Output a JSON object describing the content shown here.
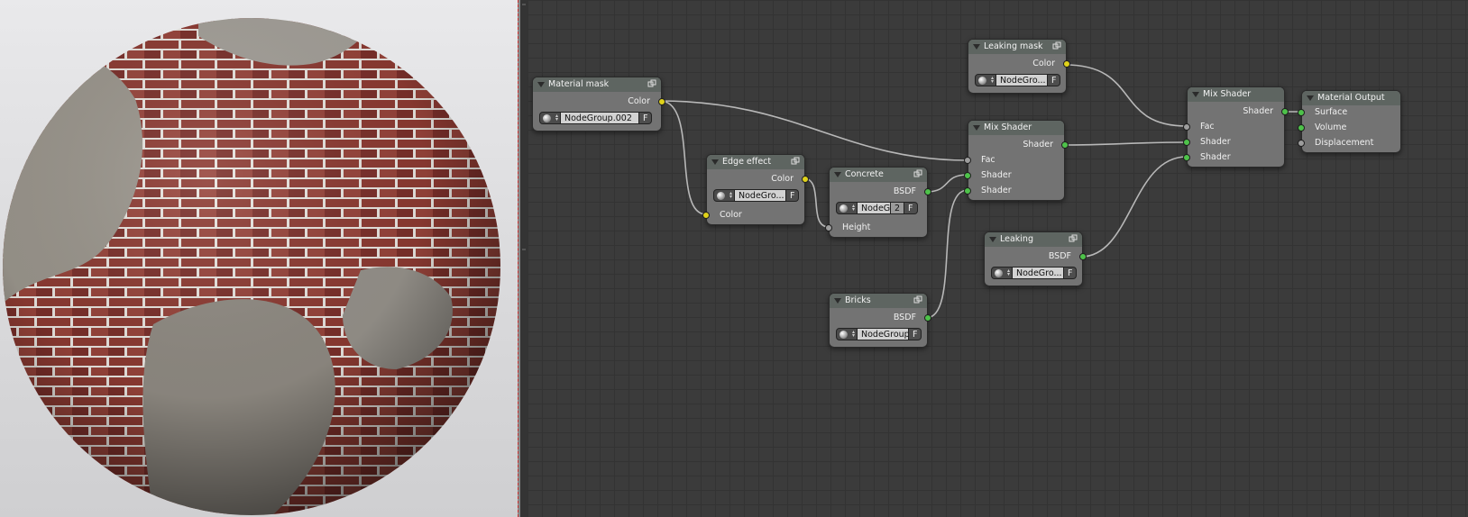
{
  "window": {
    "left_panel": "render-preview",
    "right_panel": "node-editor"
  },
  "colors": {
    "socket_color": "#e0d21a",
    "socket_shader": "#4ec24a",
    "socket_value": "#9d9d9d",
    "node_body": "#737373",
    "node_header": "#5e6561",
    "editor_bg": "#3b3b3b"
  },
  "icons": {
    "collapse": "triangle-down-icon",
    "group": "node-group-icon",
    "material": "material-sphere-icon"
  },
  "nodes": {
    "material_mask": {
      "title": "Material mask",
      "out_color": "Color",
      "group_name": "NodeGroup.002",
      "fake_user": "F"
    },
    "leaking_mask": {
      "title": "Leaking mask",
      "out_color": "Color",
      "group_name": "NodeGro...",
      "fake_user": "F"
    },
    "edge_effect": {
      "title": "Edge effect",
      "out_color": "Color",
      "in_color": "Color",
      "group_name": "NodeGro...",
      "fake_user": "F"
    },
    "concrete": {
      "title": "Concrete",
      "out_bsdf": "BSDF",
      "in_height": "Height",
      "group_name": "NodeG",
      "users": "2",
      "fake_user": "F"
    },
    "bricks": {
      "title": "Bricks",
      "out_bsdf": "BSDF",
      "group_name": "NodeGroup",
      "fake_user": "F"
    },
    "leaking": {
      "title": "Leaking",
      "out_bsdf": "BSDF",
      "group_name": "NodeGro...",
      "fake_user": "F"
    },
    "mix1": {
      "title": "Mix Shader",
      "out_shader": "Shader",
      "in_fac": "Fac",
      "in_shader1": "Shader",
      "in_shader2": "Shader"
    },
    "mix2": {
      "title": "Mix Shader",
      "out_shader": "Shader",
      "in_fac": "Fac",
      "in_shader1": "Shader",
      "in_shader2": "Shader"
    },
    "output": {
      "title": "Material Output",
      "in_surface": "Surface",
      "in_volume": "Volume",
      "in_displacement": "Displacement"
    }
  }
}
